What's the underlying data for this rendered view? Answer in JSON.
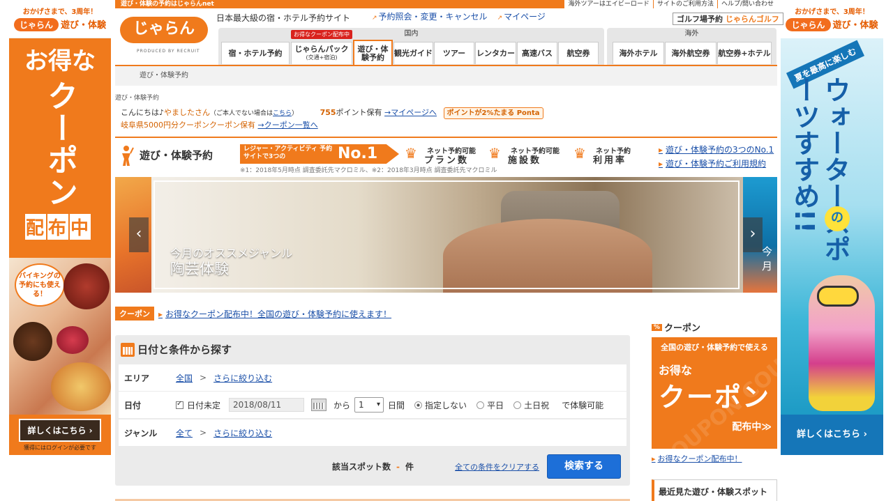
{
  "top_strip": {
    "left": "遊び・体験の予約はじゃらんnet",
    "right": [
      "海外ツアーはエイビーロード",
      "サイトのご利用方法",
      "ヘルプ/問い合わせ"
    ]
  },
  "logo": {
    "text": "じゃらん",
    "sub": "PRODUCED BY RECRUIT"
  },
  "tagline": "日本最大級の宿・ホテル予約サイト",
  "header_links": [
    "予約照会・変更・キャンセル",
    "マイページ"
  ],
  "golf": {
    "label": "ゴルフ場予約",
    "brand": "じゃらんゴルフ"
  },
  "nav": {
    "domestic_title": "国内",
    "overseas_title": "海外",
    "coupon_badge": "お得なクーポン配布中",
    "domestic": [
      {
        "label": "宿・ホテル予約",
        "sub": ""
      },
      {
        "label": "じゃらんパック",
        "sub": "(交通+宿泊)"
      },
      {
        "label": "遊び・体験予約",
        "sub": ""
      },
      {
        "label": "観光ガイド",
        "sub": ""
      },
      {
        "label": "ツアー",
        "sub": ""
      },
      {
        "label": "レンタカー",
        "sub": ""
      },
      {
        "label": "高速バス",
        "sub": ""
      },
      {
        "label": "航空券",
        "sub": ""
      }
    ],
    "overseas": [
      "海外ホテル",
      "海外航空券",
      "航空券+ホテル"
    ]
  },
  "subnav": "遊び・体験予約",
  "breadcrumb": "遊び・体験予約",
  "greeting": {
    "prefix": "こんにちは♪",
    "name": "やましたさん",
    "note_pre": "（ご本人でない場合は",
    "note_link": "こちら",
    "note_post": "）",
    "points": "755",
    "points_suffix": "ポイント保有",
    "mypage_link": "→マイページへ",
    "ponta": "ポイントが2%たまる Ponta",
    "coupon_text": "岐阜県5000円分クーポンクーポン保有",
    "coupon_link": "→クーポン一覧へ"
  },
  "section": {
    "title": "遊び・体験予約",
    "no1_small": "レジャー・アクティビティ 予約サイトで3つの",
    "no1_big": "No.1",
    "crowns": [
      {
        "l1": "ネット予約可能",
        "l2": "プラン数"
      },
      {
        "l1": "ネット予約可能",
        "l2": "施設数"
      },
      {
        "l1": "ネット予約",
        "l2": "利用率"
      }
    ],
    "footnote": "※1：2018年5月時点 調査委託先マクロミル、※2：2018年3月時点 調査委託先マクロミル",
    "links": [
      "遊び・体験予約の3つのNo.1",
      "遊び・体験予約ご利用規約"
    ]
  },
  "hero": {
    "caption1": "今月のオススメジャンル",
    "caption2": "陶芸体験",
    "right_caption": "今月",
    "prev": "‹",
    "next": "›"
  },
  "coupon_bar": {
    "label": "クーポン",
    "text": "お得なクーポン配布中！全国の遊び・体験予約に使えます！"
  },
  "search": {
    "title": "日付と条件から探す",
    "area_label": "エリア",
    "area_value": "全国",
    "area_refine": "さらに絞り込む",
    "date_label": "日付",
    "date_undecided": "日付未定",
    "date_value": "2018/08/11",
    "from": "から",
    "days_value": "1",
    "days_unit": "日間",
    "radio": [
      "指定しない",
      "平日",
      "土日祝"
    ],
    "available": "で体験可能",
    "genre_label": "ジャンル",
    "genre_value": "全て",
    "genre_refine": "さらに絞り込む",
    "count_label": "該当スポット数",
    "count_value": "-",
    "count_unit": "件",
    "clear": "全ての条件をクリアする",
    "submit": "検索する"
  },
  "right_col": {
    "coupon_head": "クーポン",
    "pct": "%",
    "ad_t1": "全国の遊び・体験予約で使える",
    "ad_t2": "お得な",
    "ad_t3": "クーポン",
    "ad_t4": "配布中≫",
    "ad_wm": "COUPON COUPON",
    "link": "お得なクーポン配布中！",
    "recent": "最近見た遊び・体験スポット"
  },
  "ad_left": {
    "small": "おかげさまで、3周年！",
    "brand": "じゃらん",
    "brand2": "遊び・体験",
    "v1": "お得な",
    "v2": "クーポン",
    "haifu": [
      "配",
      "布",
      "中"
    ],
    "bubble": "バイキングの予約にも使える！",
    "button": "詳しくはこちら ›",
    "note": "獲得にはログインが必要です"
  },
  "ad_right": {
    "small": "おかげさまで、3周年！",
    "brand": "じゃらん",
    "brand2": "遊び・体験",
    "ribbon": "夏を最高に楽しむ",
    "vertical": "ウォータースポーツすすめ!!",
    "no": "の",
    "button": "詳しくはこちら ›"
  }
}
